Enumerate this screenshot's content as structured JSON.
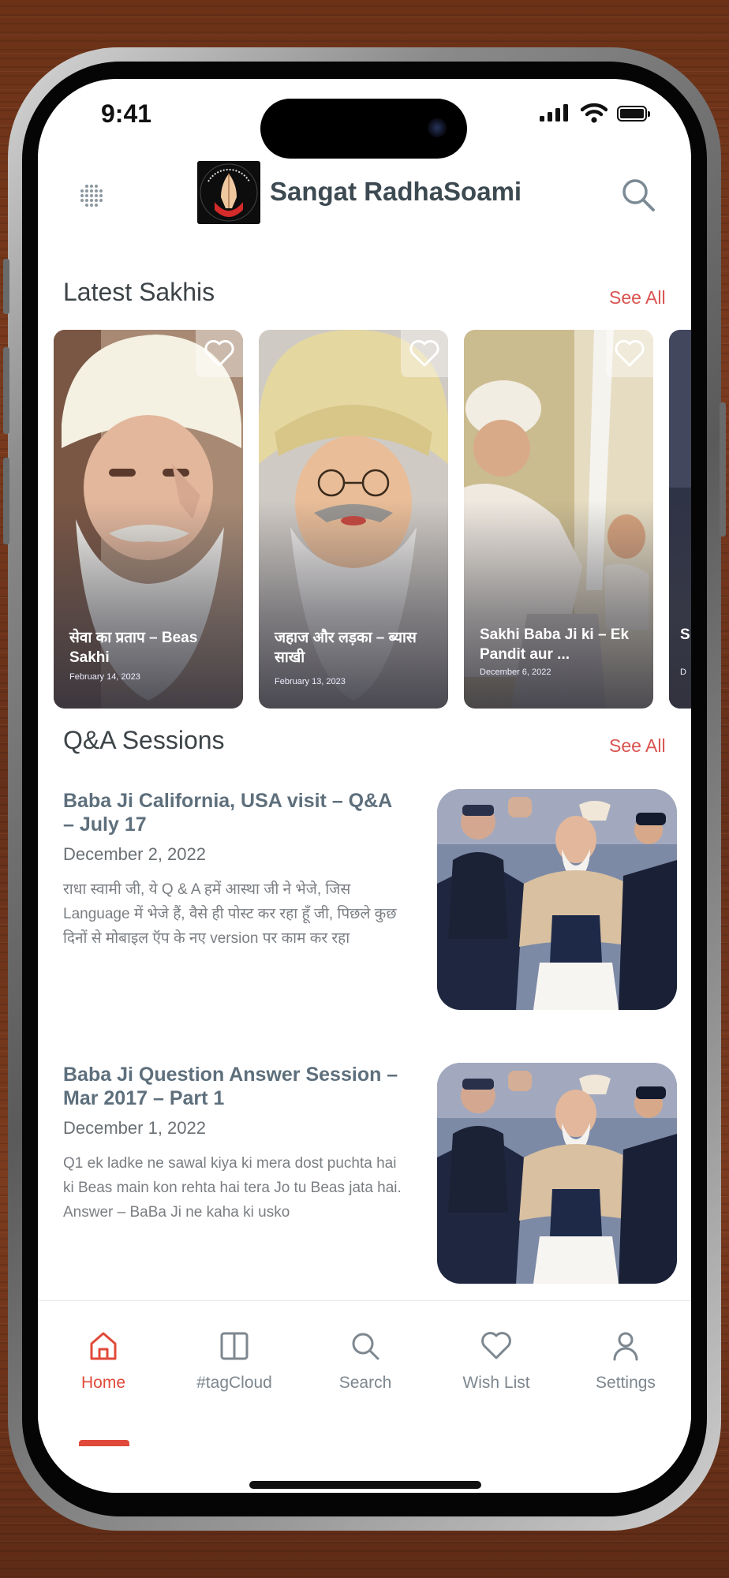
{
  "status": {
    "time": "9:41"
  },
  "header": {
    "app_title": "Sangat RadhaSoami",
    "logo_icon": "radhasoami-logo"
  },
  "latest_sakhis": {
    "title": "Latest Sakhis",
    "see_all": "See All",
    "cards": [
      {
        "title": "सेवा का प्रताप – Beas Sakhi",
        "date": "February 14, 2023"
      },
      {
        "title": "जहाज और लड़का – ब्यास साखी",
        "date": "February 13, 2023"
      },
      {
        "title": "Sakhi Baba Ji ki – Ek Pandit aur ...",
        "date": "December 6, 2022"
      },
      {
        "title": "S M",
        "date": "D"
      }
    ]
  },
  "qa_sessions": {
    "title": "Q&A Sessions",
    "see_all": "See All",
    "items": [
      {
        "title": "Baba Ji California, USA visit – Q&A – July 17",
        "date": "December 2, 2022",
        "excerpt": "राधा स्वामी जी, ये Q & A हमें आस्था जी ने भेजे, जिस Language में भेजे हैं, वैसे ही पोस्ट कर रहा हूँ जी, पिछले कुछ दिनों से मोबाइल ऍप के नए version पर काम कर रहा"
      },
      {
        "title": "Baba Ji Question Answer Session – Mar 2017 – Part 1",
        "date": "December 1, 2022",
        "excerpt": "Q1 ek ladke ne sawal kiya ki mera dost puchta hai ki Beas main kon rehta hai tera Jo tu Beas jata hai. Answer – BaBa Ji ne kaha ki usko"
      }
    ]
  },
  "tabs": [
    {
      "label": "Home",
      "icon": "home-icon",
      "active": true
    },
    {
      "label": "#tagCloud",
      "icon": "book-icon",
      "active": false
    },
    {
      "label": "Search",
      "icon": "search-icon",
      "active": false
    },
    {
      "label": "Wish List",
      "icon": "heart-icon",
      "active": false
    },
    {
      "label": "Settings",
      "icon": "user-icon",
      "active": false
    }
  ],
  "colors": {
    "accent": "#e04a3a",
    "see_all": "#d9534f",
    "title_gray": "#3d4a52"
  }
}
